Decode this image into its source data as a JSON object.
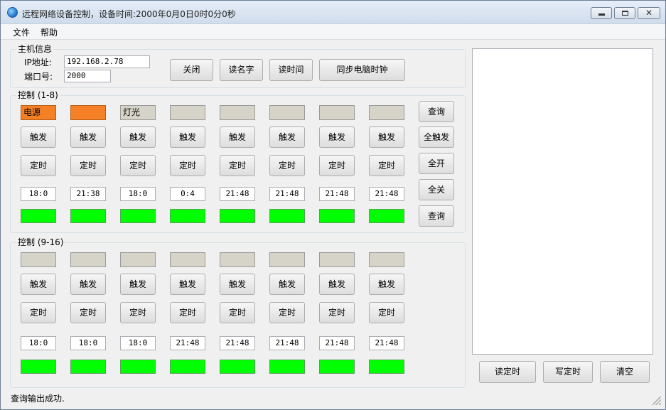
{
  "window": {
    "title": "远程网络设备控制，设备时间:2000年0月0日0时0分0秒"
  },
  "menu": [
    "文件",
    "帮助"
  ],
  "host": {
    "legend": "主机信息",
    "ip_label": "IP地址:",
    "ip_value": "192.168.2.78",
    "port_label": "端口号:",
    "port_value": "2000",
    "buttons": [
      "关闭",
      "读名字",
      "读时间",
      "同步电脑时钟"
    ]
  },
  "group1": {
    "legend": "控制 (1-8)",
    "relays": [
      {
        "name": "电源",
        "color": "orange"
      },
      {
        "name": "",
        "color": "orange"
      },
      {
        "name": "灯光",
        "color": "gray"
      },
      {
        "name": "",
        "color": "gray"
      },
      {
        "name": "",
        "color": "gray"
      },
      {
        "name": "",
        "color": "gray"
      },
      {
        "name": "",
        "color": "gray"
      },
      {
        "name": "",
        "color": "gray"
      }
    ],
    "trigger_label": "触发",
    "timer_label": "定时",
    "times": [
      "18:0",
      "21:38",
      "18:0",
      "0:4",
      "21:48",
      "21:48",
      "21:48",
      "21:48"
    ],
    "side_buttons": [
      "查询",
      "全触发",
      "全开",
      "全关",
      "查询"
    ]
  },
  "group2": {
    "legend": "控制 (9-16)",
    "relays": [
      {
        "name": "",
        "color": "gray"
      },
      {
        "name": "",
        "color": "gray"
      },
      {
        "name": "",
        "color": "gray"
      },
      {
        "name": "",
        "color": "gray"
      },
      {
        "name": "",
        "color": "gray"
      },
      {
        "name": "",
        "color": "gray"
      },
      {
        "name": "",
        "color": "gray"
      },
      {
        "name": "",
        "color": "gray"
      }
    ],
    "trigger_label": "触发",
    "timer_label": "定时",
    "times": [
      "18:0",
      "18:0",
      "18:0",
      "21:48",
      "21:48",
      "21:48",
      "21:48",
      "21:48"
    ]
  },
  "log_buttons": [
    "读定时",
    "写定时",
    "清空"
  ],
  "status": "查询输出成功.",
  "colors": {
    "orange": "#f58025",
    "gray": "#d6d3c8",
    "led": "#00ff00"
  }
}
